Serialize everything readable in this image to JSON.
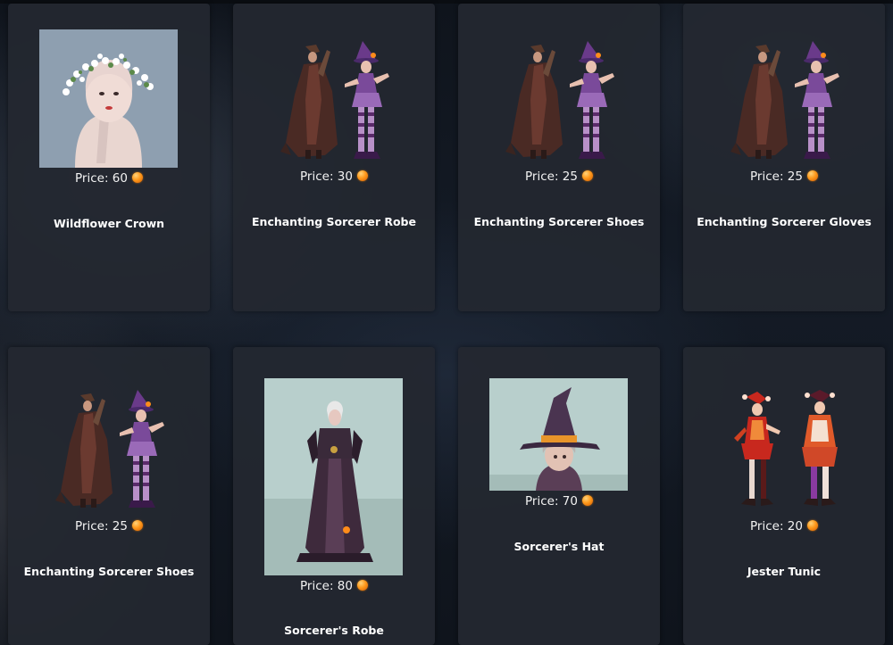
{
  "currency_icon": "orange-orb-coin-icon",
  "accent_color": "#ff9a1c",
  "items": [
    {
      "name": "Wildflower Crown",
      "price_label": "Price: 60",
      "icon": "wildflower-crown-portrait"
    },
    {
      "name": "Enchanting Sorcerer Robe",
      "price_label": "Price: 30",
      "icon": "sorcerer-pair-figures"
    },
    {
      "name": "Enchanting Sorcerer Shoes",
      "price_label": "Price: 25",
      "icon": "sorcerer-pair-figures"
    },
    {
      "name": "Enchanting Sorcerer Gloves",
      "price_label": "Price: 25",
      "icon": "sorcerer-pair-figures"
    },
    {
      "name": "Enchanting Sorcerer Shoes",
      "price_label": "Price: 25",
      "icon": "sorcerer-pair-figures"
    },
    {
      "name": "Sorcerer's Robe",
      "price_label": "Price: 80",
      "icon": "sorcerer-robe-figure"
    },
    {
      "name": "Sorcerer's Hat",
      "price_label": "Price: 70",
      "icon": "sorcerer-hat-portrait"
    },
    {
      "name": "Jester Tunic",
      "price_label": "Price: 20",
      "icon": "jester-pair-figures"
    }
  ]
}
